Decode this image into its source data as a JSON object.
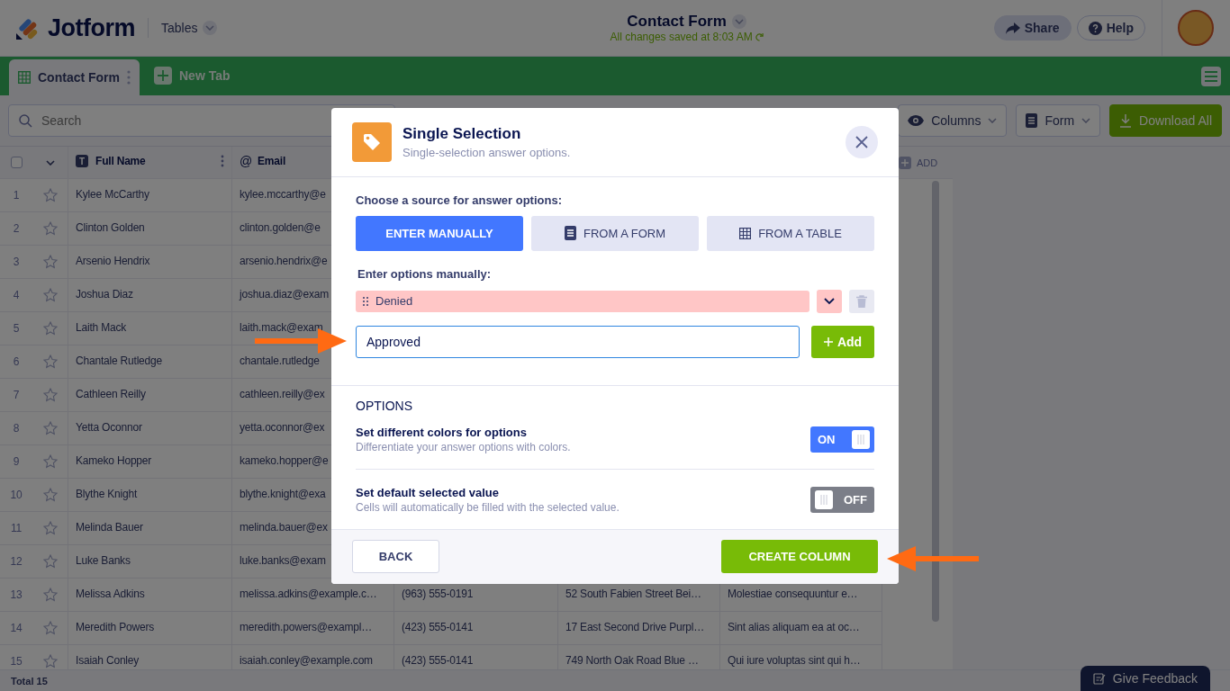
{
  "header": {
    "logo": "Jotform",
    "product": "Tables",
    "title": "Contact Form",
    "save_status": "All changes saved at 8:03 AM",
    "buttons": [
      {
        "label": "Share",
        "kind": "share"
      },
      {
        "label": "Help",
        "kind": "help"
      }
    ]
  },
  "tabs": [
    {
      "label": "Contact Form",
      "selected": true
    },
    {
      "label": "New Tab",
      "selected": false
    }
  ],
  "toolbar": {
    "search_placeholder": "Search",
    "buttons": [
      {
        "label": "Columns",
        "kind": "columns"
      },
      {
        "label": "Form",
        "kind": "form"
      },
      {
        "label": "Download All",
        "kind": "download"
      }
    ]
  },
  "table": {
    "select_all": {
      "checked": false
    },
    "columns": [
      {
        "label": "Full Name",
        "icon": "T"
      },
      {
        "label": "Email",
        "icon": "@"
      }
    ],
    "add_column": "ADD",
    "rows": [
      {
        "number": "1",
        "name": "Kylee McCarthy",
        "email": "kylee.mccarthy@e"
      },
      {
        "number": "2",
        "name": "Clinton Golden",
        "email": "clinton.golden@e"
      },
      {
        "number": "3",
        "name": "Arsenio Hendrix",
        "email": "arsenio.hendrix@e"
      },
      {
        "number": "4",
        "name": "Joshua Diaz",
        "email": "joshua.diaz@exam"
      },
      {
        "number": "5",
        "name": "Laith Mack",
        "email": "laith.mack@exam"
      },
      {
        "number": "6",
        "name": "Chantale Rutledge",
        "email": "chantale.rutledge"
      },
      {
        "number": "7",
        "name": "Cathleen Reilly",
        "email": "cathleen.reilly@ex"
      },
      {
        "number": "8",
        "name": "Yetta Oconnor",
        "email": "yetta.oconnor@ex"
      },
      {
        "number": "9",
        "name": "Kameko Hopper",
        "email": "kameko.hopper@e"
      },
      {
        "number": "10",
        "name": "Blythe Knight",
        "email": "blythe.knight@exa"
      },
      {
        "number": "11",
        "name": "Melinda Bauer",
        "email": "melinda.bauer@ex"
      },
      {
        "number": "12",
        "name": "Luke Banks",
        "email": "luke.banks@exam"
      },
      {
        "number": "13",
        "name": "Melissa Adkins",
        "email": "melissa.adkins@example.c…",
        "phone": "(963) 555-0191",
        "address": "52 South Fabien Street Bei…",
        "message": "Molestiae consequuntur e…"
      },
      {
        "number": "14",
        "name": "Meredith Powers",
        "email": "meredith.powers@exampl…",
        "phone": "(423) 555-0141",
        "address": "17 East Second Drive Purpl…",
        "message": "Sint alias aliquam ea at oc…"
      },
      {
        "number": "15",
        "name": "Isaiah Conley",
        "email": "isaiah.conley@example.com",
        "phone": "(423) 555-0141",
        "address": "749 North Oak Road Blue …",
        "message": "Qui iure voluptas sint qui h…"
      }
    ],
    "total": "Total 15"
  },
  "dialog": {
    "title": "Single Selection",
    "subtitle": "Single-selection answer options.",
    "source_label": "Choose a source for answer options:",
    "sources": [
      {
        "label": "ENTER MANUALLY",
        "kind": "manual",
        "selected": true
      },
      {
        "label": "FROM A FORM",
        "kind": "form",
        "selected": false
      },
      {
        "label": "FROM A TABLE",
        "kind": "table",
        "selected": false
      }
    ],
    "manual_label": "Enter options manually:",
    "options": [
      {
        "label": "Denied",
        "color": "#ffc6c6"
      }
    ],
    "new_option": {
      "value": "Approved"
    },
    "add_button": "Add",
    "options_heading": "OPTIONS",
    "settings": [
      {
        "title": "Set different colors for options",
        "description": "Differentiate your answer options with colors.",
        "on": true,
        "toggle_label": "ON"
      },
      {
        "title": "Set default selected value",
        "description": "Cells will automatically be filled with the selected value.",
        "on": false,
        "toggle_label": "OFF"
      }
    ],
    "back_button": "BACK",
    "create_button": "CREATE COLUMN"
  },
  "feedback_button": "Give Feedback"
}
